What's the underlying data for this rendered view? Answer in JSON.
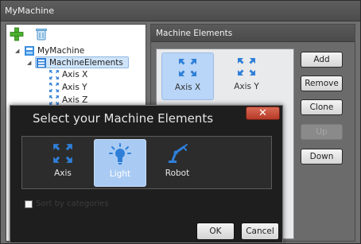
{
  "window": {
    "title": "MyMachine"
  },
  "tree": {
    "root": "MyMachine",
    "group": "MachineElements",
    "items": [
      "Axis X",
      "Axis Y",
      "Axis Z"
    ]
  },
  "right_panel": {
    "title": "Machine Elements",
    "elements": [
      {
        "label": "Axis X",
        "selected": true
      },
      {
        "label": "Axis Y",
        "selected": false
      }
    ],
    "buttons": {
      "add": "Add",
      "remove": "Remove",
      "clone": "Clone",
      "up": "Up",
      "down": "Down"
    }
  },
  "dialog": {
    "title": "Select your Machine Elements",
    "close_glyph": "✕",
    "options": [
      {
        "label": "Axis",
        "selected": false
      },
      {
        "label": "Light",
        "selected": true
      },
      {
        "label": "Robot",
        "selected": false
      }
    ],
    "sort_label": "Sort by categories",
    "sort_checked": false,
    "ok": "OK",
    "cancel": "Cancel"
  },
  "colors": {
    "accent_selected": "#b9d5f7",
    "close_red": "#c44a34",
    "icon_blue": "#2f7fd8"
  }
}
